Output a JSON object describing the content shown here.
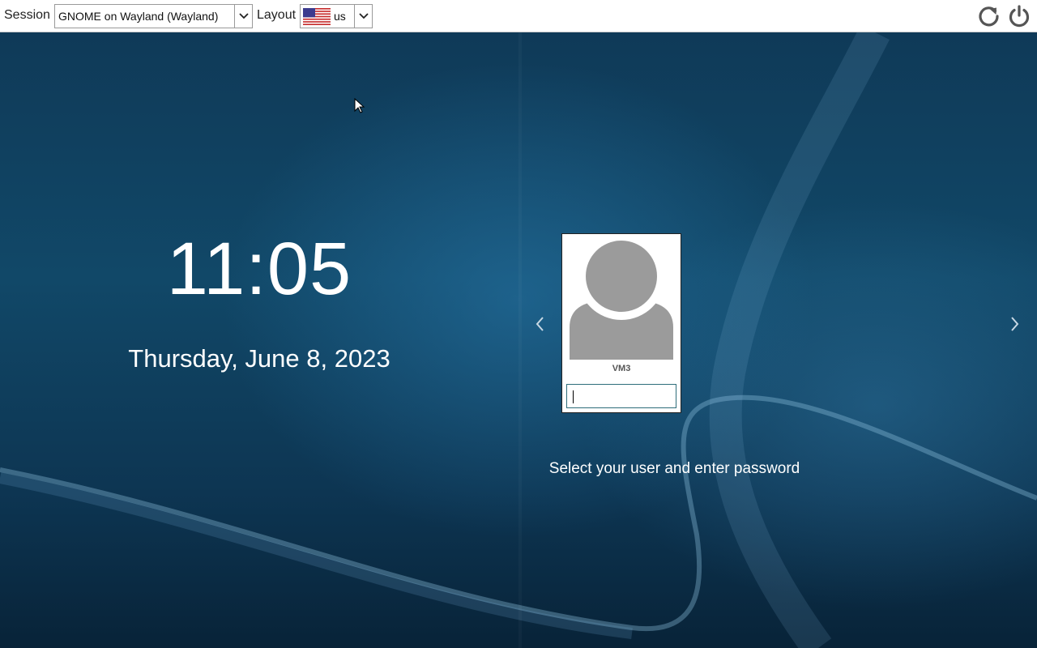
{
  "topbar": {
    "session_label": "Session",
    "session_value": "GNOME on Wayland (Wayland)",
    "layout_label": "Layout",
    "layout_value": "us",
    "layout_flag": "us-flag-icon",
    "restart_icon": "restart-icon",
    "shutdown_icon": "power-icon"
  },
  "clock": {
    "time": "11:05",
    "date": "Thursday, June 8, 2023"
  },
  "login": {
    "username": "VM3",
    "password_value": "",
    "prompt": "Select your user and enter password",
    "prev_icon": "chevron-left-icon",
    "next_icon": "chevron-right-icon"
  },
  "colors": {
    "background": "#114868",
    "accent_border": "#2e6d7a",
    "avatar_gray": "#9b9b9b"
  }
}
